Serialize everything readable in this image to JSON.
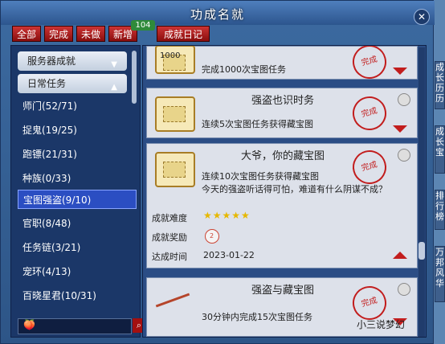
{
  "window": {
    "title": "功成名就"
  },
  "tabs": [
    {
      "label": "全部"
    },
    {
      "label": "完成"
    },
    {
      "label": "未做"
    },
    {
      "label": "新增"
    },
    {
      "label": "成就日记"
    }
  ],
  "new_count": "104",
  "categories": [
    {
      "label": "服务器成就"
    },
    {
      "label": "日常任务"
    }
  ],
  "tasks": [
    {
      "label": "师门(52/71)"
    },
    {
      "label": "捉鬼(19/25)"
    },
    {
      "label": "跑镖(21/31)"
    },
    {
      "label": "种族(0/33)"
    },
    {
      "label": "宝图强盗(9/10)"
    },
    {
      "label": "官职(8/48)"
    },
    {
      "label": "任务链(3/21)"
    },
    {
      "label": "宠环(4/13)"
    },
    {
      "label": "百晓星君(10/31)"
    }
  ],
  "cards": [
    {
      "desc": "完成1000次宝图任务",
      "icon_text": "1000"
    },
    {
      "title": "强盗也识时务",
      "desc": "连续5次宝图任务获得藏宝图"
    },
    {
      "title": "大爷，你的藏宝图",
      "desc": "连续10次宝图任务获得藏宝图",
      "tooltip": "今天的强盗听话得可怕，难道有什么阴谋不成？",
      "difficulty_label": "成就难度",
      "stars": "★★★★★",
      "reward_label": "成就奖励",
      "reward_count": "2",
      "time_label": "达成时间",
      "date": "2023-01-22"
    },
    {
      "title": "强盗与藏宝图",
      "desc": "30分钟内完成15次宝图任务"
    }
  ],
  "seal_text": "完成",
  "side_tabs": [
    {
      "label": "成长历历"
    },
    {
      "label": "成长宝"
    },
    {
      "label": "排行榜"
    },
    {
      "label": "万邦风华"
    }
  ],
  "watermark": "小三说梦幻"
}
